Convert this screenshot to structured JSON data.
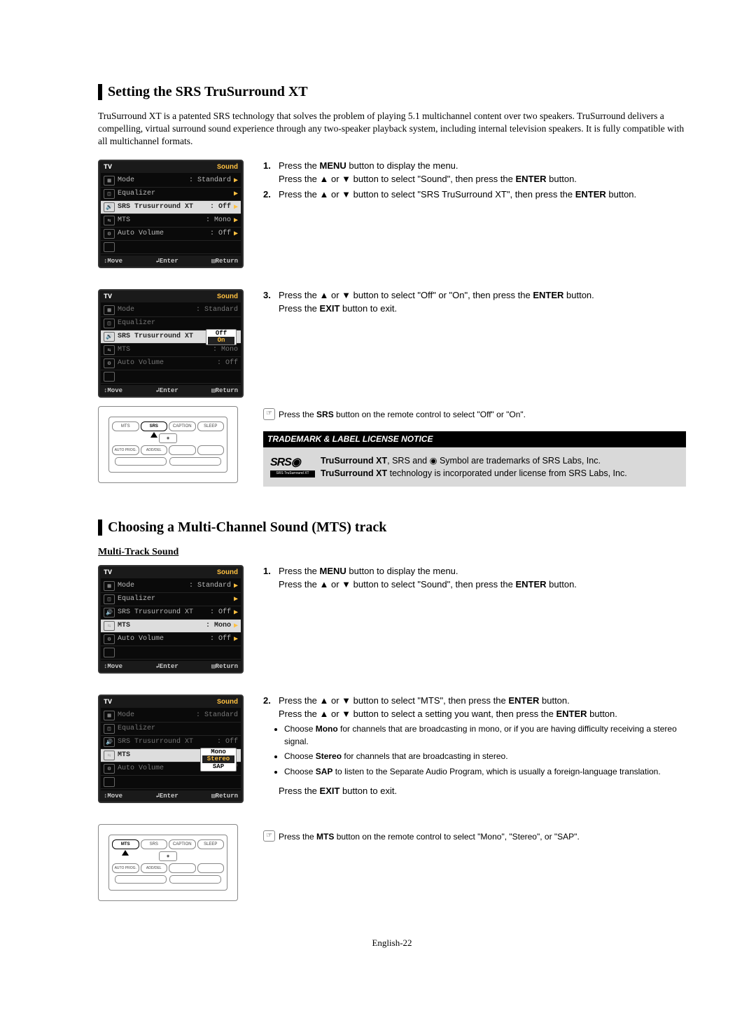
{
  "section1": {
    "title": "Setting the SRS TruSurround XT",
    "intro": "TruSurround XT is a patented SRS technology that solves the problem of playing 5.1 multichannel content over two speakers. TruSurround delivers a compelling, virtual surround sound experience through any two-speaker playback system, including internal television speakers. It is fully compatible with all multichannel formats.",
    "steps": {
      "s1a": "Press the ",
      "s1b": " button to display the menu.",
      "s1c": "Press the ▲ or ▼ button to select \"Sound\", then press the ",
      "s1d": " button.",
      "s2a": "Press the ▲ or ▼ button to select \"SRS TruSurround XT\", then press the ",
      "s2b": " button.",
      "s3a": "Press the ▲ or ▼ button to select \"Off\" or \"On\", then press the ",
      "s3b": " button.",
      "s3c": "Press the ",
      "s3d": " button to exit."
    },
    "note": "Press the SRS button on the remote control to select \"Off\" or \"On\".",
    "trademark_header": "TRADEMARK & LABEL LICENSE NOTICE",
    "trademark_text1": "TruSurround XT",
    "trademark_text2": ", SRS and ◉ Symbol are trademarks of SRS Labs, Inc.",
    "trademark_text3": "TruSurround XT",
    "trademark_text4": " technology is incorporated under license from SRS Labs, Inc.",
    "srs_logo_top": "SRS◉",
    "srs_logo_bot": "SRS TruSurround XT"
  },
  "section2": {
    "title": "Choosing a Multi-Channel Sound (MTS) track",
    "subhead": "Multi-Track Sound",
    "steps": {
      "s1a": "Press the ",
      "s1b": " button to display the menu.",
      "s1c": "Press the ▲ or ▼ button to select \"Sound\", then press the ",
      "s1d": " button.",
      "s2a": "Press the ▲ or ▼ button to select \"MTS\", then press the ",
      "s2b": " button.",
      "s2c": "Press the ▲ or ▼ button to select a setting you want, then press the ",
      "s2d": " button.",
      "b1a": "Choose ",
      "b1b": " for channels that are broadcasting in mono, or if you are having difficulty receiving a stereo signal.",
      "b2a": "Choose ",
      "b2b": " for channels that are broadcasting in stereo.",
      "b3a": "Choose ",
      "b3b": " to listen to the Separate Audio Program, which is usually a foreign-language translation.",
      "exit_a": "Press the ",
      "exit_b": " button to exit."
    },
    "note": "Press the MTS button on the remote control to select \"Mono\", \"Stereo\", or \"SAP\"."
  },
  "bold": {
    "menu": "MENU",
    "enter": "ENTER",
    "exit": "EXIT",
    "srs": "SRS",
    "mts": "MTS",
    "mono": "Mono",
    "stereo": "Stereo",
    "sap": "SAP"
  },
  "tv": {
    "header_left": "TV",
    "header_right": "Sound",
    "mode_label": "Mode",
    "mode_value": ": Standard",
    "equalizer": "Equalizer",
    "srs_label": "SRS Trusurround XT",
    "srs_off": ": Off",
    "mts_label": "MTS",
    "mts_mono": ": Mono",
    "auto_label": "Auto Volume",
    "auto_off": ": Off",
    "footer_move": "Move",
    "footer_enter": "Enter",
    "footer_return": "Return",
    "popup_off": "Off",
    "popup_on": "On",
    "popup_mono": "Mono",
    "popup_stereo": "Stereo",
    "popup_sap": "SAP"
  },
  "remote": {
    "mts": "MTS",
    "srs": "SRS",
    "caption": "CAPTION",
    "sleep": "SLEEP",
    "autoprog": "AUTO PROG.",
    "adddel": "ADD/DEL"
  },
  "page_num": "English-22"
}
